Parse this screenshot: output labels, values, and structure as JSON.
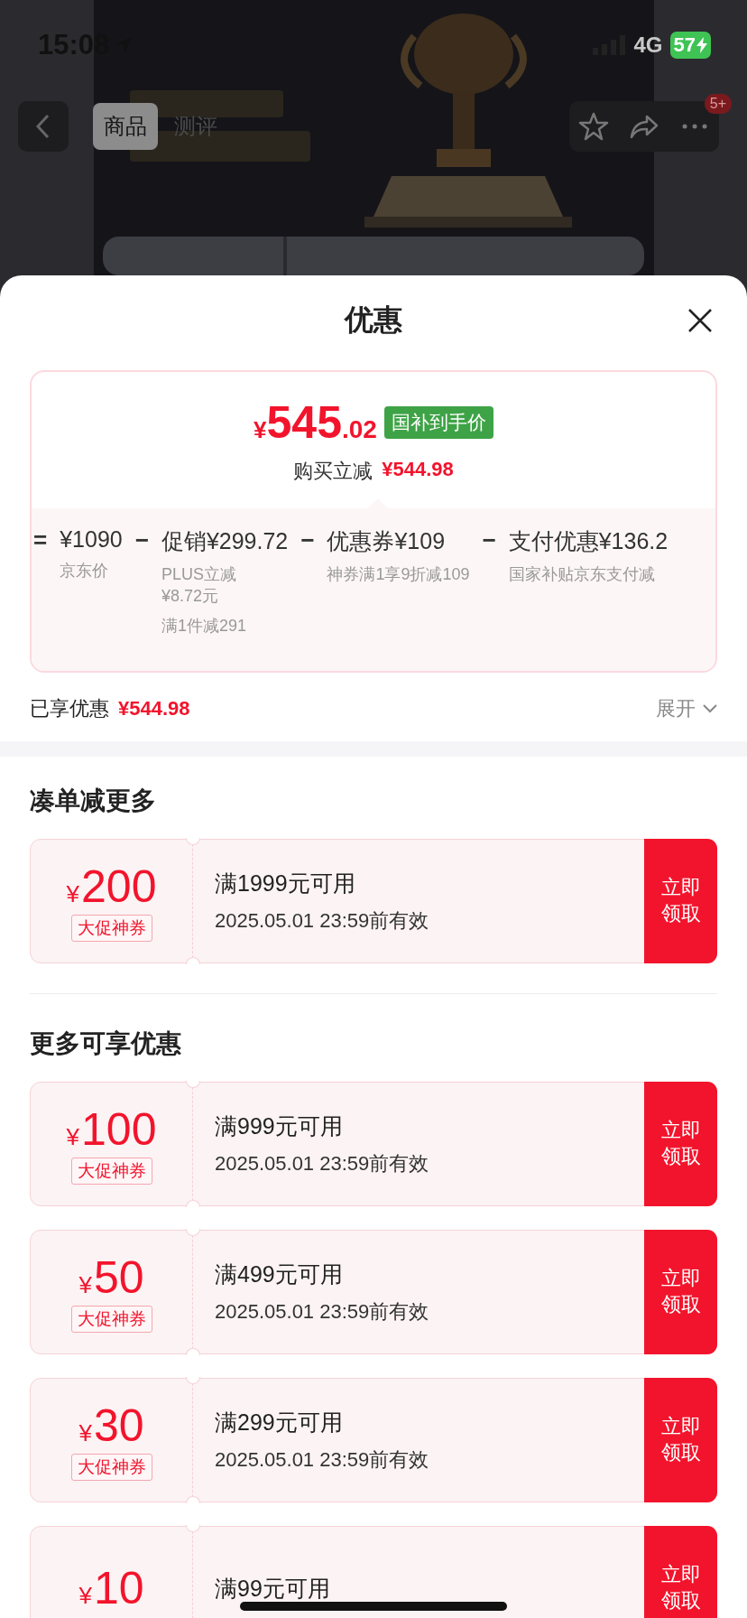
{
  "status_bar": {
    "time": "15:08",
    "network": "4G",
    "battery": "57"
  },
  "nav": {
    "tabs": [
      {
        "label": "商品",
        "selected": true
      },
      {
        "label": "测评",
        "selected": false
      }
    ],
    "badge": "5+"
  },
  "sheet": {
    "title": "优惠",
    "price": {
      "currency": "¥",
      "integer": "545",
      "decimal": ".02",
      "tag": "国补到手价",
      "saving_label": "购买立减",
      "saving": "¥544.98"
    },
    "breakdown": [
      {
        "operator": "=",
        "amount": "¥1090",
        "notes": [
          "京东价"
        ]
      },
      {
        "operator": "−",
        "amount": "促销¥299.72",
        "notes": [
          "PLUS立减\n¥8.72元",
          "满1件减291"
        ]
      },
      {
        "operator": "−",
        "amount": "优惠券¥109",
        "notes": [
          "神券满1享9折减109"
        ]
      },
      {
        "operator": "−",
        "amount": "支付优惠¥136.2",
        "notes": [
          "国家补贴京东支付减"
        ]
      }
    ],
    "enjoyed": {
      "label": "已享优惠",
      "amount": "¥544.98",
      "toggle": "展开"
    },
    "sections": [
      {
        "title": "凑单减更多",
        "coupons": [
          {
            "currency": "¥",
            "amount": "200",
            "tag": "大促神券",
            "condition": "满1999元可用",
            "validity": "2025.05.01 23:59前有效",
            "button": "立即领取"
          }
        ]
      },
      {
        "title": "更多可享优惠",
        "coupons": [
          {
            "currency": "¥",
            "amount": "100",
            "tag": "大促神券",
            "condition": "满999元可用",
            "validity": "2025.05.01 23:59前有效",
            "button": "立即领取"
          },
          {
            "currency": "¥",
            "amount": "50",
            "tag": "大促神券",
            "condition": "满499元可用",
            "validity": "2025.05.01 23:59前有效",
            "button": "立即领取"
          },
          {
            "currency": "¥",
            "amount": "30",
            "tag": "大促神券",
            "condition": "满299元可用",
            "validity": "2025.05.01 23:59前有效",
            "button": "立即领取"
          },
          {
            "currency": "¥",
            "amount": "10",
            "condition": "满99元可用",
            "button": "立即领取"
          }
        ]
      }
    ]
  }
}
